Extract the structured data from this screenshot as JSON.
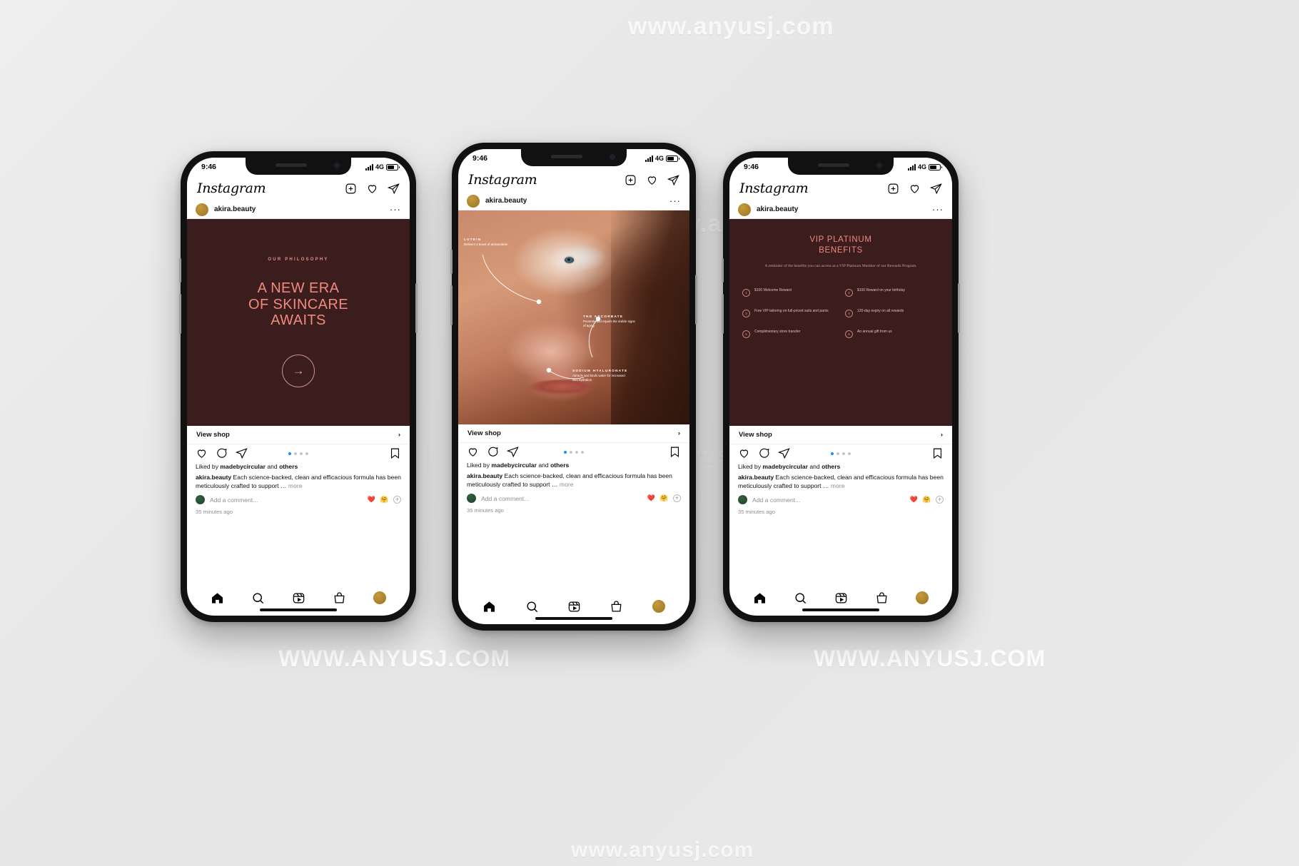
{
  "watermarks": {
    "top": "www.anyusj.com",
    "middle": "www.anyusj.com",
    "image": "www.anyusj.com",
    "left": "WWW.ANYUSJ.COM",
    "right": "WWW.ANYUSJ.COM",
    "bottom": "www.anyusj.com"
  },
  "status_bar": {
    "time": "9:46",
    "network": "4G"
  },
  "app": {
    "logo": "Instagram"
  },
  "header_icons": {
    "add": "plus-square-icon",
    "like": "heart-icon",
    "share": "paper-plane-icon"
  },
  "post": {
    "username": "akira.beauty",
    "menu": "···",
    "view_shop": "View shop",
    "chevron": "›",
    "liked_by_prefix": "Liked by ",
    "liked_by_user": "madebycircular",
    "liked_by_suffix": " and ",
    "liked_by_others": "others",
    "caption_user": "akira.beauty",
    "caption_text": " Each science-backed, clean and efficacious formula has been meticulously crafted to support … ",
    "caption_more": "more",
    "comment_placeholder": "Add a comment...",
    "emoji_heart": "❤️",
    "emoji_hug": "🤗",
    "add_emoji": "+",
    "timestamp": "35 minutes ago"
  },
  "carousel": {
    "total": 4,
    "active_index": 0
  },
  "slides": {
    "philosophy": {
      "eyebrow": "OUR PHILOSOPHY",
      "title_line1": "A NEW ERA",
      "title_line2": "OF SKINCARE",
      "title_line3": "AWAITS",
      "arrow": "→"
    },
    "portrait": {
      "annotations": [
        {
          "label": "LUTEIN",
          "text": "Delivers a boost of antioxidants"
        },
        {
          "label": "THD ASCORBATE",
          "text": "Prevents and repairs the visible signs of aging"
        },
        {
          "label": "SODIUM HYALURONATE",
          "text": "Attracts and binds water for increased skin hydration"
        }
      ]
    },
    "vip": {
      "title_line1": "VIP PLATINUM",
      "title_line2": "BENEFITS",
      "subtitle": "A reminder of the benefits you can access as a VIP Platinum Member of our Rewards Program.",
      "benefits": [
        {
          "num": "1",
          "text": "$100 Welcome Reward"
        },
        {
          "num": "2",
          "text": "$100 Reward on your birthday"
        },
        {
          "num": "3",
          "text": "Free VIP tailoring on full-priced suits and pants"
        },
        {
          "num": "4",
          "text": "120-day expiry on all rewards"
        },
        {
          "num": "5",
          "text": "Complimentary store transfer"
        },
        {
          "num": "6",
          "text": "An annual gift from us"
        }
      ]
    }
  },
  "tabbar": {
    "home": "home-icon",
    "search": "search-icon",
    "reels": "reels-icon",
    "shop": "shop-bag-icon",
    "profile": "profile-avatar"
  },
  "colors": {
    "brand_dark": "#3b1d1d",
    "accent_pink": "#f08a7e",
    "avatar_gold": "#b8882e",
    "dot_active": "#1e8fe1"
  }
}
